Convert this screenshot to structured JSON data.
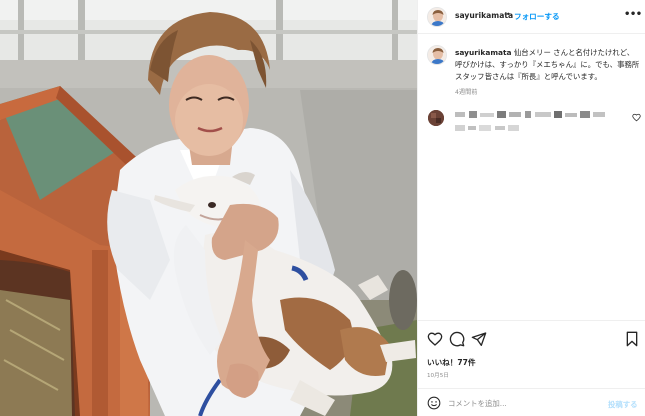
{
  "header": {
    "username": "sayurikamata",
    "separator": "•",
    "follow_label": "フォローする",
    "more_icon": "more-horizontal-icon"
  },
  "caption": {
    "username": "sayurikamata",
    "text": " 仙台メリー さんと名付けたけれど、呼びかけは、すっかり『メエちゃん』に。でも、事務所スタッフ皆さんは『所長』と呼んでいます。",
    "timestamp": "4週間前"
  },
  "comment": {
    "heart_icon": "heart-outline-icon"
  },
  "actions": {
    "like_icon": "heart-outline-icon",
    "comment_icon": "comment-bubble-icon",
    "share_icon": "paper-plane-icon",
    "save_icon": "bookmark-icon"
  },
  "likes_text": "いいね！77件",
  "date_text": "10月5日",
  "add_comment": {
    "placeholder": "コメントを追加...",
    "post_label": "投稿する",
    "emoji_icon": "smile-emoji-icon"
  },
  "colors": {
    "link_blue": "#0095f6",
    "post_disabled": "#b2dffc",
    "secondary_text": "#8e8e8e",
    "divider": "#efefef"
  }
}
